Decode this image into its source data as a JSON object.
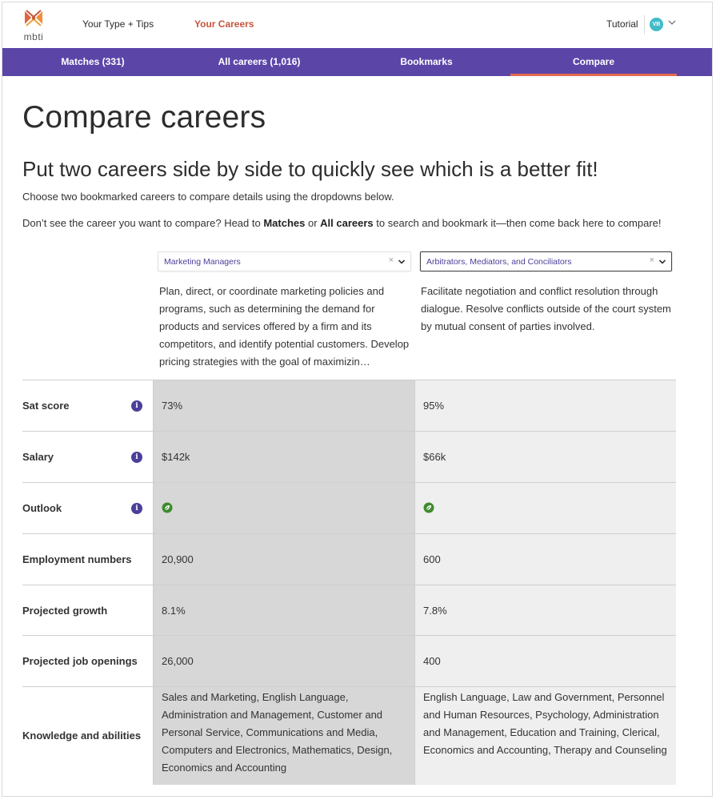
{
  "header": {
    "logo_text": "mbti",
    "nav": [
      "Your Type + Tips",
      "Your Careers"
    ],
    "tutorial_label": "Tutorial",
    "avatar_initials": "VB"
  },
  "subnav": {
    "tabs": [
      "Matches (331)",
      "All careers (1,016)",
      "Bookmarks",
      "Compare"
    ],
    "active_tab": "Compare"
  },
  "page": {
    "title": "Compare careers",
    "subtitle": "Put two careers side by side to quickly see which is a better fit!",
    "instruction": "Choose two bookmarked careers to compare details using the dropdowns below.",
    "hint_prefix": "Don’t see the career you want to compare? Head to ",
    "hint_matches": "Matches",
    "hint_or": " or ",
    "hint_all_careers": "All careers",
    "hint_suffix": " to search and bookmark it—then come back here to compare!"
  },
  "compare": {
    "career1": {
      "name": "Marketing Managers",
      "description": "Plan, direct, or coordinate marketing policies and programs, such as determining the demand for products and services offered by a firm and its competitors, and identify potential customers. Develop pricing strategies with the goal of maximizin…"
    },
    "career2": {
      "name": "Arbitrators, Mediators, and Conciliators",
      "description": "Facilitate negotiation and conflict resolution through dialogue. Resolve conflicts outside of the court system by mutual consent of parties involved."
    },
    "clear_glyph": "×",
    "rows": [
      {
        "label": "Sat score",
        "c1": "73%",
        "c2": "95%"
      },
      {
        "label": "Salary",
        "c1": "$142k",
        "c2": "$66k"
      },
      {
        "label": "Outlook",
        "c1_icon": "outlook-leaf-icon",
        "c2_icon": "outlook-leaf-icon"
      },
      {
        "label": "Employment numbers",
        "c1": "20,900",
        "c2": "600"
      },
      {
        "label": "Projected growth",
        "c1": "8.1%",
        "c2": "7.8%"
      },
      {
        "label": "Projected job openings",
        "c1": "26,000",
        "c2": "400"
      },
      {
        "label": "Knowledge and abilities",
        "c1": "Sales and Marketing, English Language, Administration and Management, Customer and Personal Service, Communications and Media, Computers and Electronics, Mathematics, Design, Economics and Accounting",
        "c2": "English Language, Law and Government, Personnel and Human Resources, Psychology, Administration and Management, Education and Training, Clerical, Economics and Accounting, Therapy and Counseling"
      }
    ],
    "info_glyph": "i"
  },
  "colors": {
    "brand_purple": "#5b46a8",
    "accent_orange": "#c8553d",
    "tab_underline": "#e46a4e",
    "outlook_green": "#3f8a2e",
    "avatar_teal": "#42bbc8"
  }
}
